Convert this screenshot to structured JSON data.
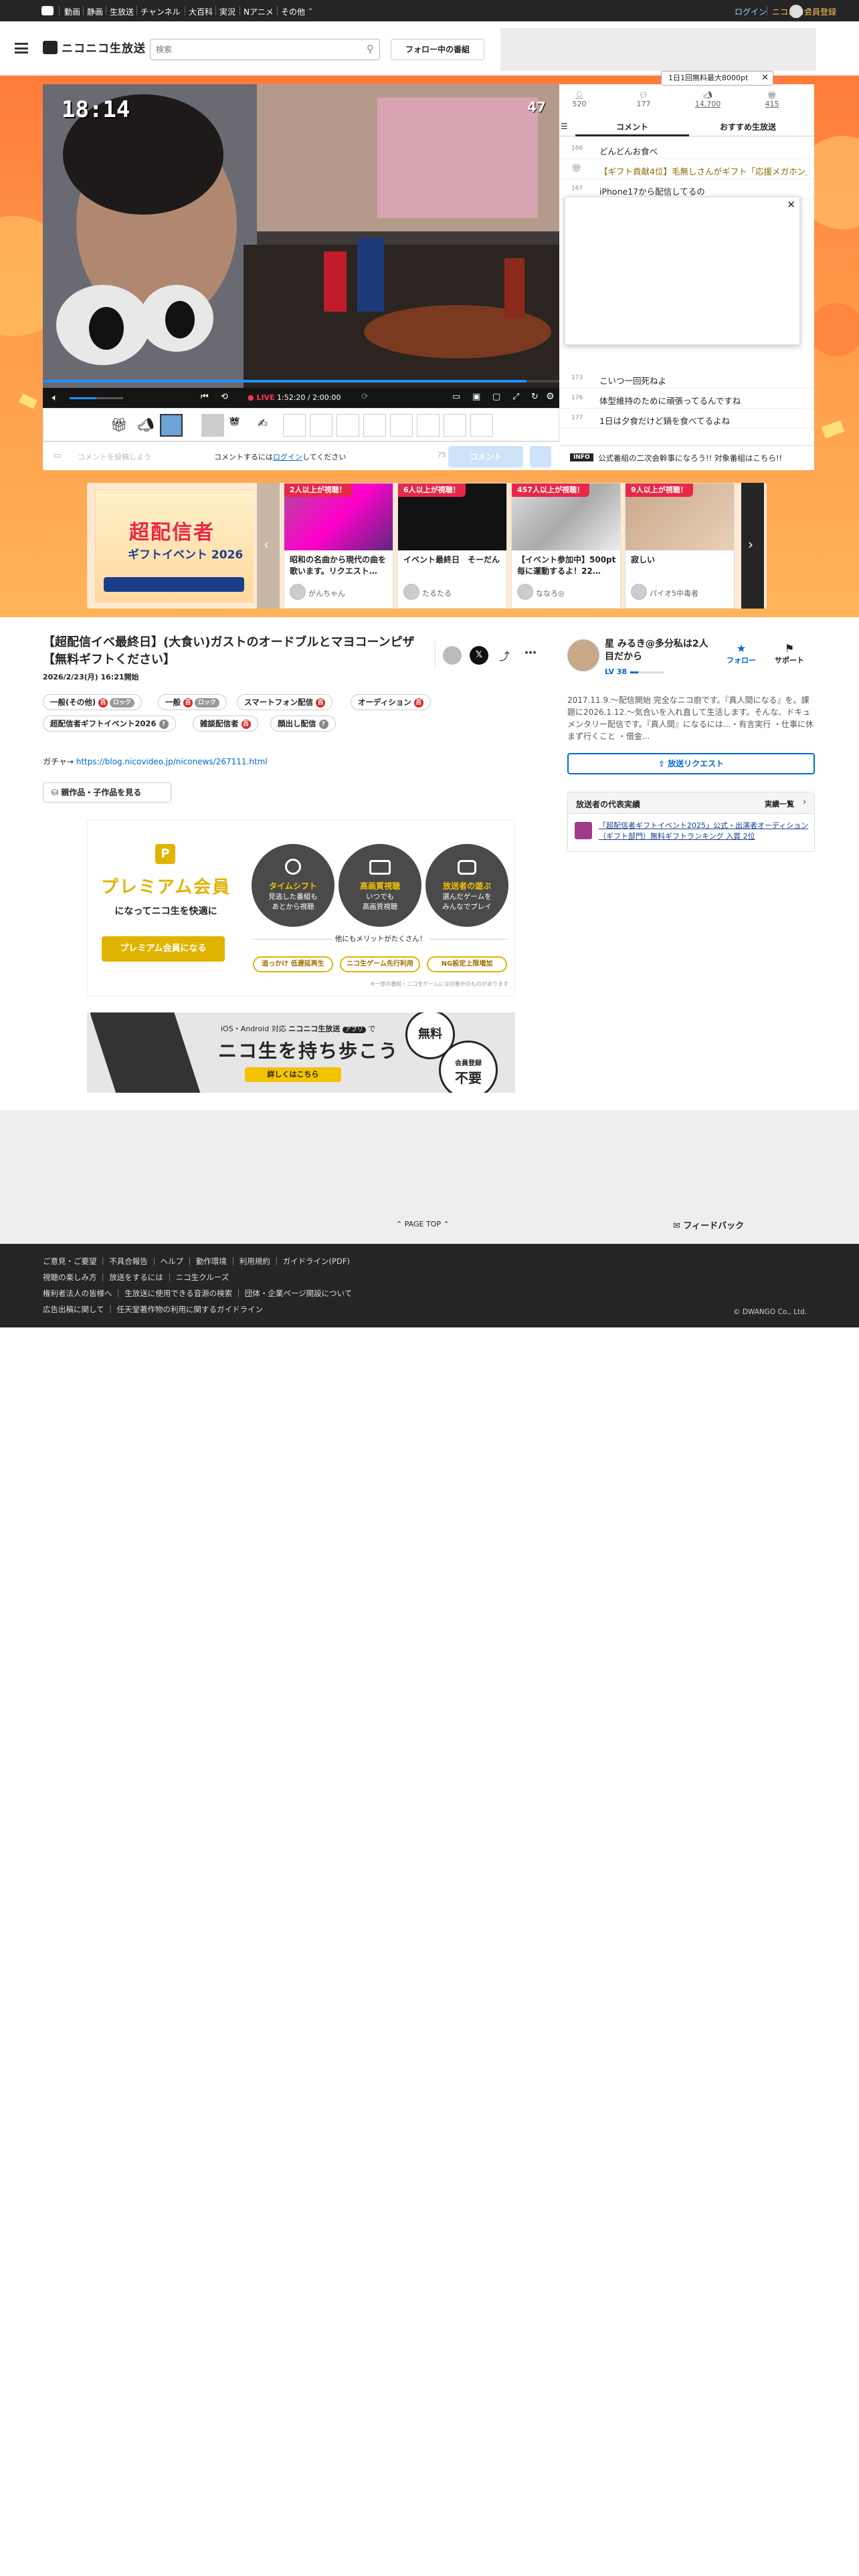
{
  "global_nav": {
    "items": [
      "動画",
      "静画",
      "生放送",
      "チャンネル",
      "大百科",
      "実況",
      "Nアニメ",
      "その他"
    ],
    "login": "ログイン",
    "register": "ニコニコ会員登録"
  },
  "header": {
    "logo": "ニコニコ生放送",
    "search_placeholder": "検索",
    "follow_button": "フォロー中の番組"
  },
  "promo_tooltip": "1日1回無料最大8000pt",
  "player": {
    "elapsed_overlay": "18:14",
    "count_overlay": "47",
    "live_label": "LIVE",
    "time": "1:52:20 / 2:00:00",
    "progress": 0.936
  },
  "stats": [
    {
      "icon": "viewer-icon",
      "value": "520"
    },
    {
      "icon": "comment-count-icon",
      "value": "177"
    },
    {
      "icon": "ad-icon",
      "value": "14,700"
    },
    {
      "icon": "gift-icon",
      "value": "415"
    }
  ],
  "comment_tabs": [
    "コメント",
    "おすすめ生放送"
  ],
  "comments": [
    {
      "no": "166",
      "text": "どんどんお食べ"
    },
    {
      "no": "",
      "text": "【ギフト貢献4位】毛無しさんがギフト「応援メガホン」"
    },
    {
      "no": "167",
      "text": "iPhone17から配信してるの"
    },
    {
      "no": "173",
      "text": "こいつ一回死ねよ"
    },
    {
      "no": "176",
      "text": "体型維持のために頑張ってるんですね"
    },
    {
      "no": "177",
      "text": "1日は夕食だけど鍋を食べてるよね"
    }
  ],
  "info_bar": {
    "badge": "INFO",
    "text": "公式番組の二次会幹事になろう!! 対象番組はこちら!!"
  },
  "comment_form": {
    "placeholder": "コメントを投稿しよう",
    "login_prompt_before": "コメントするには",
    "login_link": "ログイン",
    "login_prompt_after": "してください",
    "submit": "コメント"
  },
  "carousel": {
    "banner_title": "超配信者",
    "banner_subtitle": "ギフトイベント 2026",
    "cards": [
      {
        "badge": "2人以上が視聴！",
        "title": "昭和の名曲から現代の曲を歌います。リクエスト…",
        "channel": "がんちゃん"
      },
      {
        "badge": "6人以上が視聴！",
        "title": "イベント最終日　そーだん",
        "channel": "たるたる"
      },
      {
        "badge": "457人以上が視聴！",
        "title": "【イベント参加中】500pt毎に運動するよ！22…",
        "channel": "ななろ◎"
      },
      {
        "badge": "9人以上が視聴！",
        "title": "寂しい",
        "channel": "パイオ5中毒者"
      }
    ]
  },
  "program": {
    "title": "【超配信イベ最終日】(大食い)ガストのオードブルとマヨコーンピザ【無料ギフトください】",
    "start": "2026/2/23(月) 16:21開始",
    "tags_row1": [
      "一般(その他)",
      "一般",
      "スマートフォン配信",
      "オーディション"
    ],
    "tags_row2": [
      "超配信者ギフトイベント2026",
      "雑談配信者",
      "顔出し配信"
    ],
    "lock_label": "ロック",
    "description_prefix": "ガチャ→ ",
    "description_link": "https://blog.nicovideo.jp/niconews/267111.html",
    "child_button": "親作品・子作品を見る"
  },
  "broadcaster": {
    "name": "星 みるき@多分私は2人目だから",
    "level": "LV 38",
    "follow": "フォロー",
    "support": "サポート",
    "bio": "2017.11.9.〜配信開始 完全なニコ廚です。『真人間になる』を。課題に2026.1.12.〜気合いを入れ直して生活します。そんな、ドキュメンタリー配信です。『真人間』になるには...・有言実行 ・仕事に休まず行くこと ・借金...",
    "request_button": "放送リクエスト",
    "achievements_label": "放送者の代表実績",
    "achievements_link": "実績一覧",
    "achievement": "「超配信者ギフトイベント2025」公式・出演者オーディション（ギフト部門）無料ギフトランキング 入賞 2位"
  },
  "premium": {
    "badge": "P",
    "title": "プレミアム会員",
    "subtitle": "になってニコ生を快適に",
    "cta": "プレミアム会員になる",
    "features": [
      {
        "head": "タイムシフト",
        "body": "見逃した番組も\nあとから視聴"
      },
      {
        "head": "高画質視聴",
        "body": "いつでも\n高画質視聴"
      },
      {
        "head": "放送者の遊ぶ",
        "body": "選んだゲームを\nみんなでプレイ"
      }
    ],
    "other_label": "他にもメリットがたくさん！",
    "pills": [
      "追っかけ 低遅延再生",
      "ニコ生ゲーム先行利用",
      "NG設定上限増加"
    ],
    "note": "※一部の番組・ニコ生ゲームには対象外のものがあります"
  },
  "app_banner": {
    "platforms": "iOS・Android 対応",
    "brand": "ニコニコ生放送",
    "app": "アプリ",
    "suffix": "で",
    "headline": "ニコ生を持ち歩こう",
    "cta": "詳しくはこちら",
    "bubble1": "無料",
    "bubble2a": "会員登録",
    "bubble2b": "不要"
  },
  "page_top": "PAGE TOP",
  "feedback": "フィードバック",
  "footer": {
    "row1": [
      "ご意見・ご要望",
      "不具合報告",
      "ヘルプ",
      "動作環境",
      "利用規約",
      "ガイドライン(PDF)"
    ],
    "row2": [
      "視聴の楽しみ方",
      "放送をするには",
      "ニコ生クルーズ"
    ],
    "row3": [
      "権利者法人の皆様へ",
      "生放送に使用できる音源の検索",
      "団体・企業ページ開設について"
    ],
    "row4": [
      "広告出稿に関して",
      "任天堂著作物の利用に関するガイドライン"
    ],
    "copyright": "© DWANGO Co., Ltd."
  },
  "colors": {
    "accent": "#0069d4",
    "live": "#e8284a",
    "premium": "#e0b400",
    "dark": "#252525"
  }
}
